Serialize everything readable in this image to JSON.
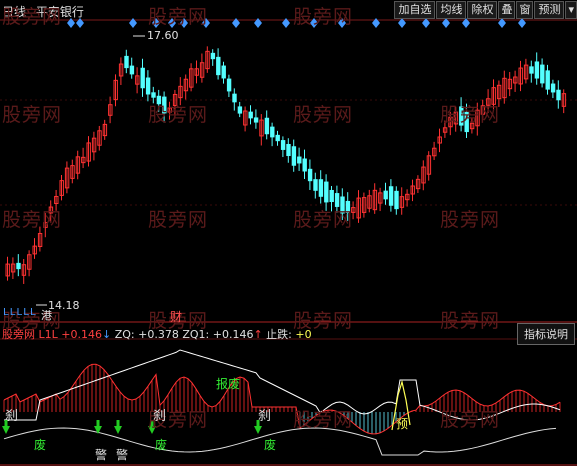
{
  "header": {
    "period": "日线",
    "stock_name": "平安银行"
  },
  "toolbar": {
    "buttons": [
      "加自选",
      "均线",
      "除权",
      "叠",
      "窗",
      "预测"
    ],
    "menu_icon": "chevron-down-icon"
  },
  "price_chart": {
    "high_label": "17.60",
    "low_label": "14.18",
    "annotation_cai": "财",
    "annotation_gang": "港",
    "markers_text": "L L L L L"
  },
  "watermark": {
    "text": "股旁网"
  },
  "indicator": {
    "name": "股旁网 L1L",
    "l1l_value": "+0.146",
    "zq_label": "ZQ:",
    "zq_value": "+0.378",
    "zq1_label": "ZQ1:",
    "zq1_value": "+0.146",
    "stop_label": "止跌:",
    "stop_value": "+0",
    "explain_button": "指标说明"
  },
  "indicator_labels": {
    "baofei": "报废",
    "sha1": "刹",
    "sha2": "刹",
    "sha3": "刹",
    "fei1": "废",
    "fei2": "废",
    "fei3": "废",
    "jing1": "警",
    "jing2": "警",
    "yu": "预"
  },
  "colors": {
    "up": "#ff3232",
    "down": "#54ffff",
    "diamond": "#4499ff",
    "white": "#ffffff",
    "yellow": "#ffff55",
    "green": "#22cc22",
    "indicator_fill": "#cc2222"
  }
}
